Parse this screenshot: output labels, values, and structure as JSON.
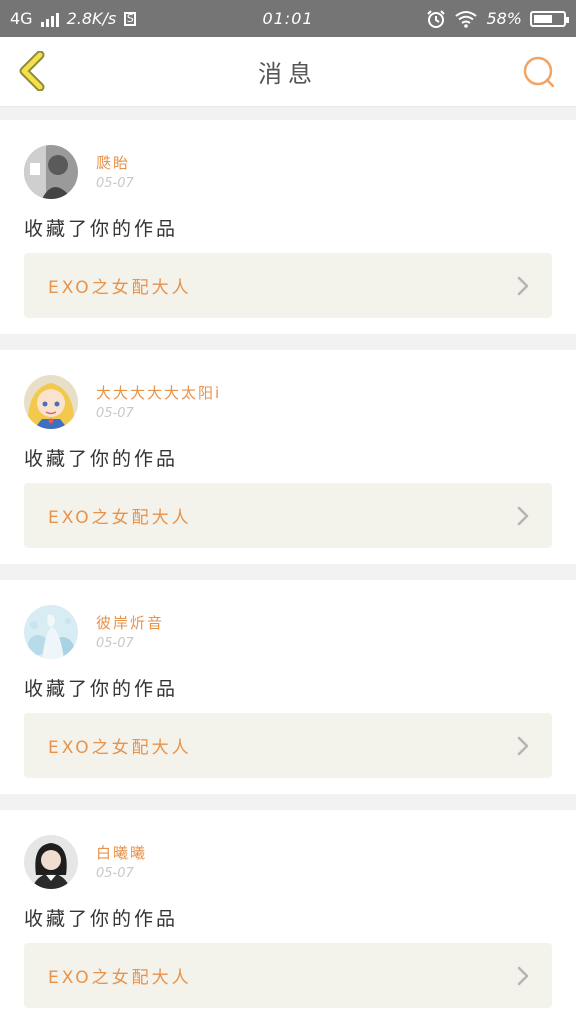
{
  "status_bar": {
    "network": "4G",
    "speed": "2.8K/s",
    "s_badge": "S",
    "time": "01:01",
    "battery": "58%",
    "icons": [
      "signal-icon",
      "alarm-icon",
      "wifi-icon",
      "battery-icon"
    ]
  },
  "header": {
    "title": "消息",
    "back_icon": "chevron-left-icon",
    "search_icon": "search-icon"
  },
  "messages": [
    {
      "user": "瓞眙",
      "date": "05-07",
      "action": "收藏了你的作品",
      "work": "EXO之女配大人",
      "avatar": "photo-avatar-gray"
    },
    {
      "user": "大大大大大太阳i",
      "date": "05-07",
      "action": "收藏了你的作品",
      "work": "EXO之女配大人",
      "avatar": "anime-avatar-blonde"
    },
    {
      "user": "彼岸炘音",
      "date": "05-07",
      "action": "收藏了你的作品",
      "work": "EXO之女配大人",
      "avatar": "anime-avatar-lightblue"
    },
    {
      "user": "白曦曦",
      "date": "05-07",
      "action": "收藏了你的作品",
      "work": "EXO之女配大人",
      "avatar": "photo-avatar-dark"
    }
  ],
  "colors": {
    "accent": "#e8924a",
    "back_icon_fill": "#f4e04a",
    "back_icon_stroke": "#8a8a3a",
    "status_bar": "#757575",
    "work_bg": "#f3f3ec"
  }
}
